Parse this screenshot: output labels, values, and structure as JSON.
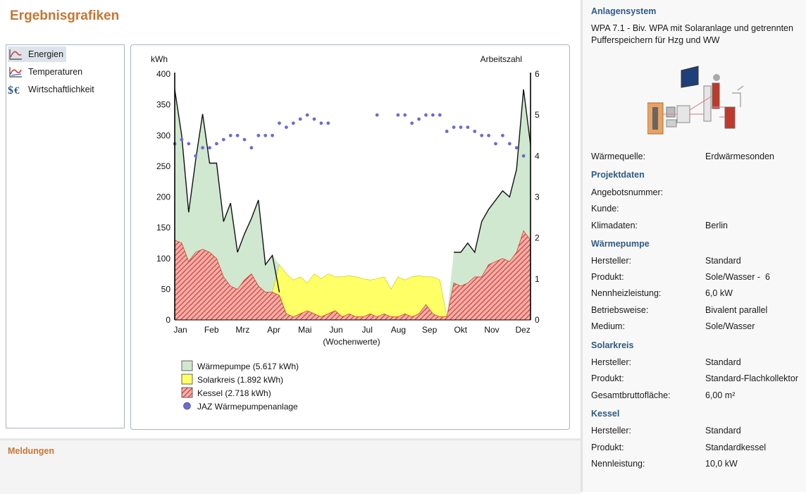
{
  "page": {
    "title": "Ergebnisgrafiken"
  },
  "nav": {
    "items": [
      {
        "label": "Energien",
        "icon": "energy-chart-icon",
        "selected": true
      },
      {
        "label": "Temperaturen",
        "icon": "temperature-chart-icon",
        "selected": false
      },
      {
        "label": "Wirtschaftlichkeit",
        "icon": "currency-icon",
        "selected": false
      }
    ]
  },
  "messages": {
    "title": "Meldungen"
  },
  "colors": {
    "accent_orange": "#c87533",
    "section_blue": "#2f5a84",
    "waermepumpe_fill": "#cfe8cf",
    "solar_fill": "#ffff66",
    "kessel_fill": "#e05050",
    "jaz_dot": "#6b6bd6"
  },
  "chart_data": {
    "type": "area",
    "ylabel": "kWh",
    "y2label": "Arbeitszahl",
    "xlabel": "(Wochenwerte)",
    "ylim": [
      0,
      400
    ],
    "y2lim": [
      0,
      6
    ],
    "yticks": [
      0,
      50,
      100,
      150,
      200,
      250,
      300,
      350,
      400
    ],
    "y2ticks": [
      0,
      1,
      2,
      3,
      4,
      5,
      6
    ],
    "months": [
      "Jan",
      "Feb",
      "Mrz",
      "Apr",
      "Mai",
      "Jun",
      "Jul",
      "Aug",
      "Sep",
      "Okt",
      "Nov",
      "Dez"
    ],
    "weeks": [
      1,
      2,
      3,
      4,
      5,
      6,
      7,
      8,
      9,
      10,
      11,
      12,
      13,
      14,
      15,
      16,
      17,
      18,
      19,
      20,
      21,
      22,
      23,
      24,
      25,
      26,
      27,
      28,
      29,
      30,
      31,
      32,
      33,
      34,
      35,
      36,
      37,
      38,
      39,
      40,
      41,
      42,
      43,
      44,
      45,
      46,
      47,
      48,
      49,
      50,
      51,
      52
    ],
    "series": [
      {
        "name": "Wärmepumpe (5.617 kWh)",
        "style": "stack-top",
        "values": [
          375,
          300,
          175,
          260,
          335,
          255,
          255,
          160,
          190,
          110,
          140,
          165,
          195,
          90,
          105,
          45,
          0,
          0,
          0,
          0,
          0,
          0,
          0,
          0,
          0,
          0,
          0,
          0,
          0,
          0,
          0,
          0,
          0,
          0,
          0,
          0,
          0,
          0,
          0,
          0,
          110,
          110,
          125,
          110,
          160,
          180,
          195,
          210,
          200,
          245,
          375,
          285
        ]
      },
      {
        "name": "Solarkreis (1.892 kWh)",
        "style": "stack",
        "values": [
          0,
          0,
          0,
          0,
          0,
          0,
          0,
          0,
          0,
          0,
          0,
          0,
          0,
          0,
          0,
          50,
          65,
          60,
          60,
          45,
          65,
          62,
          65,
          55,
          65,
          62,
          65,
          62,
          55,
          62,
          60,
          45,
          65,
          55,
          65,
          62,
          45,
          60,
          60,
          0,
          0,
          0,
          0,
          0,
          0,
          0,
          0,
          0,
          0,
          0,
          0,
          0
        ]
      },
      {
        "name": "Kessel (2.718 kWh)",
        "style": "base-hatched",
        "values": [
          130,
          125,
          95,
          110,
          115,
          110,
          100,
          70,
          55,
          50,
          65,
          75,
          55,
          45,
          45,
          40,
          10,
          5,
          10,
          15,
          10,
          5,
          10,
          15,
          5,
          10,
          5,
          5,
          10,
          5,
          10,
          5,
          5,
          10,
          5,
          10,
          25,
          10,
          5,
          5,
          60,
          55,
          60,
          70,
          70,
          90,
          95,
          100,
          95,
          110,
          145,
          130
        ]
      }
    ],
    "jaz": {
      "name": "JAZ Wärmepumpenanlage",
      "type": "scatter",
      "x": [
        1,
        2,
        3,
        4,
        5,
        6,
        7,
        8,
        9,
        10,
        11,
        12,
        13,
        14,
        15,
        16,
        17,
        18,
        19,
        20,
        21,
        22,
        23,
        30,
        33,
        34,
        35,
        36,
        37,
        38,
        39,
        40,
        41,
        42,
        43,
        44,
        45,
        46,
        47,
        48,
        49,
        50,
        51
      ],
      "y": [
        4.3,
        4.4,
        4.3,
        4.0,
        4.2,
        4.2,
        4.3,
        4.4,
        4.5,
        4.5,
        4.4,
        4.2,
        4.5,
        4.5,
        4.5,
        4.8,
        4.7,
        4.8,
        4.9,
        5.0,
        4.9,
        4.8,
        4.8,
        5.0,
        5.0,
        5.0,
        4.8,
        4.9,
        5.0,
        5.0,
        5.0,
        4.6,
        4.7,
        4.7,
        4.7,
        4.6,
        4.5,
        4.5,
        4.3,
        4.5,
        4.3,
        4.2,
        4.0
      ]
    },
    "legend": "below-chart"
  },
  "side": {
    "system_title": "Anlagensystem",
    "system_desc": "WPA 7.1 - Biv. WPA mit Solaranlage und getrennten Pufferspeichern für Hzg und WW",
    "source_label": "Wärmequelle:",
    "source_value": "Erdwärmesonden",
    "project_title": "Projektdaten",
    "project": [
      {
        "label": "Angebotsnummer:",
        "value": ""
      },
      {
        "label": "Kunde:",
        "value": ""
      },
      {
        "label": "Klimadaten:",
        "value": "Berlin"
      }
    ],
    "hp_title": "Wärmepumpe",
    "hp": [
      {
        "label": "Hersteller:",
        "value": "Standard"
      },
      {
        "label": "Produkt:",
        "value": "Sole/Wasser -  6"
      },
      {
        "label": "Nennheizleistung:",
        "value": "6,0 kW"
      },
      {
        "label": "Betriebsweise:",
        "value": "Bivalent parallel"
      },
      {
        "label": "Medium:",
        "value": "Sole/Wasser"
      }
    ],
    "solar_title": "Solarkreis",
    "solar": [
      {
        "label": "Hersteller:",
        "value": "Standard"
      },
      {
        "label": "Produkt:",
        "value": "Standard-Flachkollektor"
      },
      {
        "label": "Gesamtbruttofläche:",
        "value": "6,00 m²"
      }
    ],
    "boiler_title": "Kessel",
    "boiler": [
      {
        "label": "Hersteller:",
        "value": "Standard"
      },
      {
        "label": "Produkt:",
        "value": "Standardkessel"
      },
      {
        "label": "Nennleistung:",
        "value": "10,0 kW"
      }
    ]
  }
}
